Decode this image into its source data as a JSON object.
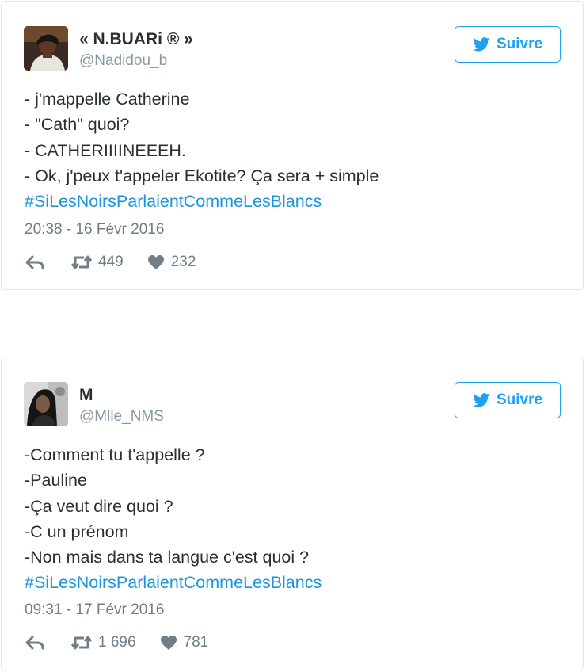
{
  "tweets": [
    {
      "display_name": "« N.BUARi ® »",
      "handle": "@Nadidou_b",
      "follow_label": "Suivre",
      "lines": [
        "- j'mappelle Catherine",
        "- \"Cath\" quoi?",
        "- CATHERIIIINEEEH.",
        "- Ok, j'peux t'appeler Ekotite? Ça sera + simple"
      ],
      "hashtag": "#SiLesNoirsParlaientCommeLesBlancs",
      "timestamp": "20:38 - 16 Févr 2016",
      "retweets": "449",
      "likes": "232"
    },
    {
      "display_name": "M",
      "handle": "@Mlle_NMS",
      "follow_label": "Suivre",
      "lines": [
        "-Comment tu t'appelle ?",
        "-Pauline",
        "-Ça veut dire quoi ?",
        "-C un prénom",
        "-Non mais dans ta langue c'est quoi ?"
      ],
      "hashtag": "#SiLesNoirsParlaientCommeLesBlancs",
      "timestamp": "09:31 - 17 Févr 2016",
      "retweets": "1 696",
      "likes": "781"
    }
  ],
  "colors": {
    "brand": "#1da1f2",
    "hashtag": "#1b95e0",
    "meta": "#707e88",
    "text": "#292f33",
    "border": "#e1e8ed"
  },
  "icons": {
    "follow": "twitter-bird-icon",
    "reply": "reply-icon",
    "retweet": "retweet-icon",
    "like": "heart-icon"
  }
}
